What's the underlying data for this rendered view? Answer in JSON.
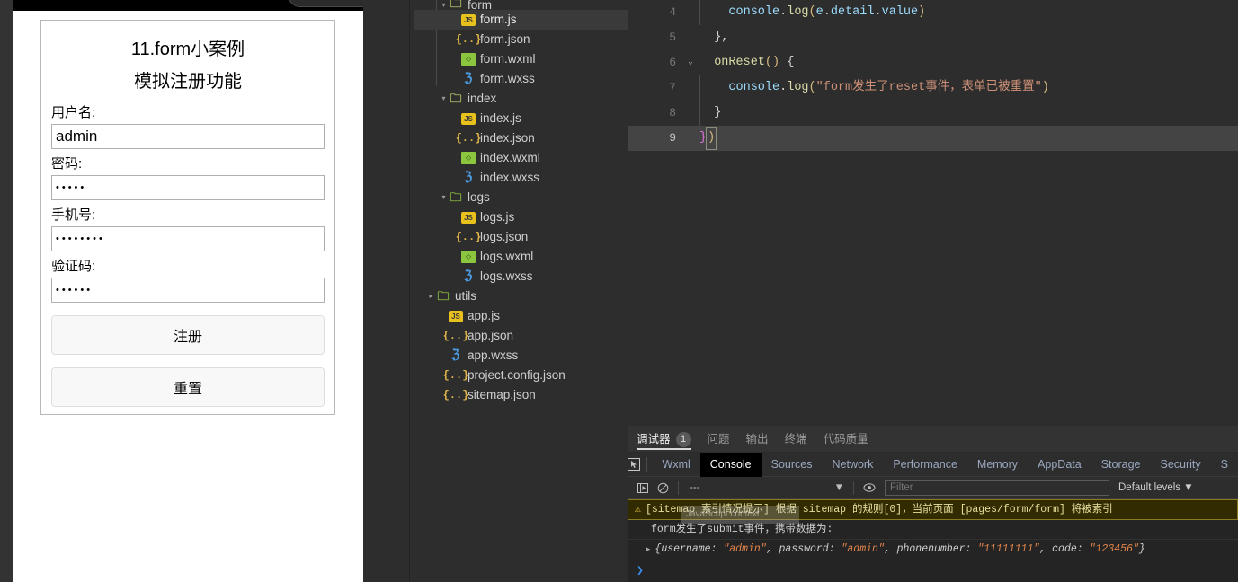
{
  "simulator": {
    "page": {
      "title_line1": "11.form小案例",
      "title_line2": "模拟注册功能",
      "fields": [
        {
          "label": "用户名:",
          "value": "admin",
          "masked": false,
          "name": "username"
        },
        {
          "label": "密码:",
          "value": "•••••",
          "masked": true,
          "name": "password"
        },
        {
          "label": "手机号:",
          "value": "••••••••",
          "masked": true,
          "name": "phonenumber"
        },
        {
          "label": "验证码:",
          "value": "••••••",
          "masked": true,
          "name": "code"
        }
      ],
      "submit_label": "注册",
      "reset_label": "重置"
    }
  },
  "file_tree": {
    "rows": [
      {
        "indent": 1,
        "twisty": "▾",
        "icon": "folder-icon",
        "icon_class": "ic-folder",
        "glyph": "🗀",
        "label": "form",
        "selected": false,
        "clipped_top": true
      },
      {
        "indent": 2,
        "twisty": "",
        "icon": "js-file-icon",
        "icon_class": "ic-js",
        "glyph": "JS",
        "label": "form.js",
        "selected": true
      },
      {
        "indent": 2,
        "twisty": "",
        "icon": "json-file-icon",
        "icon_class": "ic-json",
        "glyph": "{..}",
        "label": "form.json",
        "selected": false
      },
      {
        "indent": 2,
        "twisty": "",
        "icon": "wxml-file-icon",
        "icon_class": "ic-wxml",
        "glyph": "◇",
        "label": "form.wxml",
        "selected": false
      },
      {
        "indent": 2,
        "twisty": "",
        "icon": "wxss-file-icon",
        "icon_class": "ic-wxss",
        "glyph": "ℨ",
        "label": "form.wxss",
        "selected": false
      },
      {
        "indent": 1,
        "twisty": "▾",
        "icon": "folder-icon",
        "icon_class": "ic-folder",
        "glyph": "🗀",
        "label": "index",
        "selected": false
      },
      {
        "indent": 2,
        "twisty": "",
        "icon": "js-file-icon",
        "icon_class": "ic-js",
        "glyph": "JS",
        "label": "index.js",
        "selected": false
      },
      {
        "indent": 2,
        "twisty": "",
        "icon": "json-file-icon",
        "icon_class": "ic-json",
        "glyph": "{..}",
        "label": "index.json",
        "selected": false
      },
      {
        "indent": 2,
        "twisty": "",
        "icon": "wxml-file-icon",
        "icon_class": "ic-wxml",
        "glyph": "◇",
        "label": "index.wxml",
        "selected": false
      },
      {
        "indent": 2,
        "twisty": "",
        "icon": "wxss-file-icon",
        "icon_class": "ic-wxss",
        "glyph": "ℨ",
        "label": "index.wxss",
        "selected": false
      },
      {
        "indent": 1,
        "twisty": "▾",
        "icon": "folder-icon",
        "icon_class": "ic-folder-g",
        "glyph": "🗀",
        "label": "logs",
        "selected": false
      },
      {
        "indent": 2,
        "twisty": "",
        "icon": "js-file-icon",
        "icon_class": "ic-js",
        "glyph": "JS",
        "label": "logs.js",
        "selected": false
      },
      {
        "indent": 2,
        "twisty": "",
        "icon": "json-file-icon",
        "icon_class": "ic-json",
        "glyph": "{..}",
        "label": "logs.json",
        "selected": false
      },
      {
        "indent": 2,
        "twisty": "",
        "icon": "wxml-file-icon",
        "icon_class": "ic-wxml",
        "glyph": "◇",
        "label": "logs.wxml",
        "selected": false
      },
      {
        "indent": 2,
        "twisty": "",
        "icon": "wxss-file-icon",
        "icon_class": "ic-wxss",
        "glyph": "ℨ",
        "label": "logs.wxss",
        "selected": false
      },
      {
        "indent": 0,
        "twisty": "▸",
        "icon": "folder-icon",
        "icon_class": "ic-folder-g",
        "glyph": "🗀",
        "label": "utils",
        "selected": false
      },
      {
        "indent": 1,
        "twisty": "",
        "icon": "js-file-icon",
        "icon_class": "ic-js",
        "glyph": "JS",
        "label": "app.js",
        "selected": false
      },
      {
        "indent": 1,
        "twisty": "",
        "icon": "json-file-icon",
        "icon_class": "ic-json",
        "glyph": "{..}",
        "label": "app.json",
        "selected": false
      },
      {
        "indent": 1,
        "twisty": "",
        "icon": "wxss-file-icon",
        "icon_class": "ic-wxss",
        "glyph": "ℨ",
        "label": "app.wxss",
        "selected": false
      },
      {
        "indent": 1,
        "twisty": "",
        "icon": "json-file-icon",
        "icon_class": "ic-json",
        "glyph": "{..}",
        "label": "project.config.json",
        "selected": false
      },
      {
        "indent": 1,
        "twisty": "",
        "icon": "json-file-icon",
        "icon_class": "ic-json",
        "glyph": "{..}",
        "label": "sitemap.json",
        "selected": false
      }
    ]
  },
  "editor": {
    "lines": [
      {
        "num": "4",
        "fold": "",
        "indent_guide": true,
        "active": false,
        "tokens": [
          {
            "t": "    ",
            "c": "t-plain"
          },
          {
            "t": "console",
            "c": "t-obj"
          },
          {
            "t": ".",
            "c": "t-punct"
          },
          {
            "t": "log",
            "c": "t-fn"
          },
          {
            "t": "(",
            "c": "t-paren1"
          },
          {
            "t": "e",
            "c": "t-obj"
          },
          {
            "t": ".",
            "c": "t-punct"
          },
          {
            "t": "detail",
            "c": "t-obj"
          },
          {
            "t": ".",
            "c": "t-punct"
          },
          {
            "t": "value",
            "c": "t-obj"
          },
          {
            "t": ")",
            "c": "t-paren1"
          }
        ]
      },
      {
        "num": "5",
        "fold": "",
        "indent_guide": false,
        "active": false,
        "tokens": [
          {
            "t": "  ",
            "c": "t-plain"
          },
          {
            "t": "},",
            "c": "t-punct"
          }
        ]
      },
      {
        "num": "6",
        "fold": "⌄",
        "indent_guide": false,
        "active": false,
        "tokens": [
          {
            "t": "  ",
            "c": "t-plain"
          },
          {
            "t": "onReset",
            "c": "t-fn"
          },
          {
            "t": "()",
            "c": "t-paren1"
          },
          {
            "t": " ",
            "c": "t-plain"
          },
          {
            "t": "{",
            "c": "t-punct"
          }
        ]
      },
      {
        "num": "7",
        "fold": "",
        "indent_guide": true,
        "active": false,
        "tokens": [
          {
            "t": "    ",
            "c": "t-plain"
          },
          {
            "t": "console",
            "c": "t-obj"
          },
          {
            "t": ".",
            "c": "t-punct"
          },
          {
            "t": "log",
            "c": "t-fn"
          },
          {
            "t": "(",
            "c": "t-paren1"
          },
          {
            "t": "\"form发生了reset事件，表单已被重置\"",
            "c": "t-str"
          },
          {
            "t": ")",
            "c": "t-paren1"
          }
        ]
      },
      {
        "num": "8",
        "fold": "",
        "indent_guide": true,
        "active": false,
        "tokens": [
          {
            "t": "  ",
            "c": "t-plain"
          },
          {
            "t": "}",
            "c": "t-punct"
          }
        ]
      },
      {
        "num": "9",
        "fold": "",
        "indent_guide": false,
        "active": true,
        "tokens": [
          {
            "t": "}",
            "c": "t-paren2"
          }
        ],
        "cursor_token": {
          "t": ")",
          "c": "t-paren1"
        }
      }
    ]
  },
  "devtools": {
    "top_tabs": [
      {
        "label": "调试器",
        "active": true,
        "badge": "1"
      },
      {
        "label": "问题",
        "active": false,
        "badge": ""
      },
      {
        "label": "输出",
        "active": false,
        "badge": ""
      },
      {
        "label": "终端",
        "active": false,
        "badge": ""
      },
      {
        "label": "代码质量",
        "active": false,
        "badge": ""
      }
    ],
    "panel_tabs": [
      {
        "label": "Wxml",
        "active": false
      },
      {
        "label": "Console",
        "active": true
      },
      {
        "label": "Sources",
        "active": false
      },
      {
        "label": "Network",
        "active": false
      },
      {
        "label": "Performance",
        "active": false
      },
      {
        "label": "Memory",
        "active": false
      },
      {
        "label": "AppData",
        "active": false
      },
      {
        "label": "Storage",
        "active": false
      },
      {
        "label": "Security",
        "active": false
      },
      {
        "label": "S",
        "active": false
      }
    ],
    "toolbar": {
      "execute_icon": "step-into-icon",
      "clear_icon": "clear-console-icon",
      "context_value": "---",
      "context_caret": "▼",
      "eye_icon": "live-expression-icon",
      "filter_placeholder": "Filter",
      "levels_label": "Default levels",
      "levels_caret": "▼"
    },
    "console_rows": [
      {
        "kind": "warning",
        "icon": "warning-triangle-icon",
        "text": "[sitemap 索引情况提示] 根据 sitemap 的规则[0]，当前页面 [pages/form/form] 将被索引"
      },
      {
        "kind": "log",
        "text": "form发生了submit事件，携带数据为:"
      },
      {
        "kind": "object",
        "arrow": "▶",
        "prefix": "{username: ",
        "parts": [
          {
            "text": "\"admin\"",
            "style": "string"
          },
          {
            "text": ", password: ",
            "style": "key"
          },
          {
            "text": "\"admin\"",
            "style": "string"
          },
          {
            "text": ", phonenumber: ",
            "style": "key"
          },
          {
            "text": "\"11111111\"",
            "style": "string"
          },
          {
            "text": ", code: ",
            "style": "key"
          },
          {
            "text": "\"123456\"",
            "style": "string"
          },
          {
            "text": "}",
            "style": "key"
          }
        ]
      }
    ],
    "prompt_glyph": "❯",
    "ghost_tooltip": "JavaScript context"
  },
  "colors": {
    "editor_bg": "#2d2d2d",
    "active_line": "#444444",
    "tree_bg": "#2d2d2d",
    "tree_selected": "#3a3a3a",
    "devtools_bg": "#242424",
    "console_tab_active": "#000000",
    "warning_bg": "#332b00",
    "warning_border": "#8a7a20",
    "string_color": "#ce9178",
    "prompt_blue": "#3b8eea"
  }
}
